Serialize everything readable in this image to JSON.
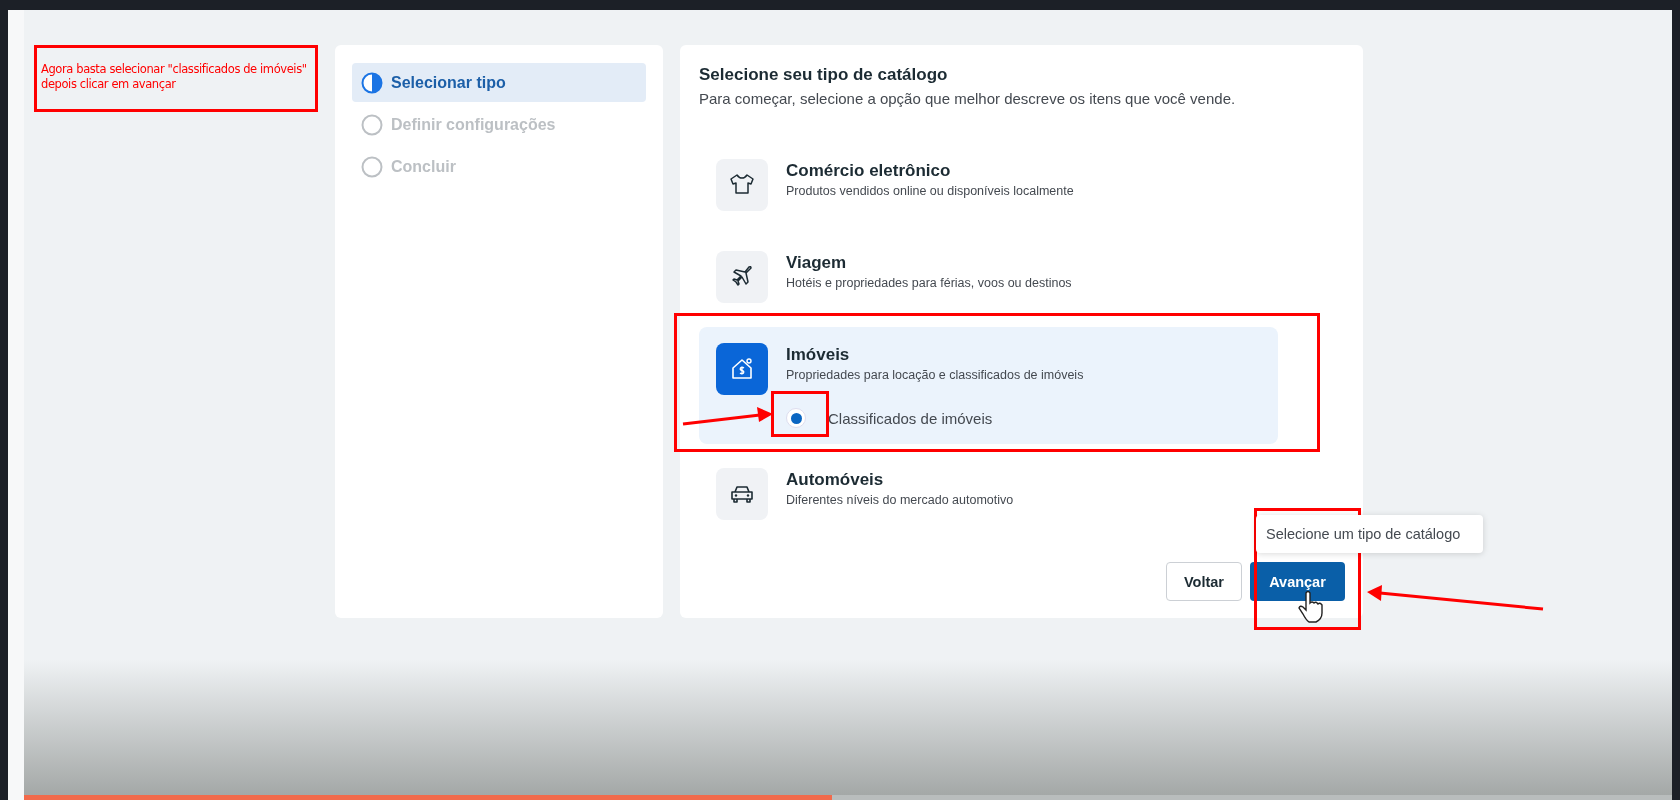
{
  "annotation": {
    "lines": [
      "Agora basta selecionar \"classificados de imóveis\"",
      "depois clicar em avançar"
    ]
  },
  "steps": [
    {
      "label": "Selecionar tipo",
      "selected": true
    },
    {
      "label": "Definir configurações",
      "selected": false
    },
    {
      "label": "Concluir",
      "selected": false
    }
  ],
  "catalog": {
    "title": "Selecione seu tipo de catálogo",
    "subtitle": "Para começar, selecione a opção que melhor descreve os itens que você vende.",
    "options": [
      {
        "kind": "shirt",
        "title": "Comércio eletrônico",
        "description": "Produtos vendidos online ou disponíveis localmente",
        "selected": false
      },
      {
        "kind": "plane",
        "title": "Viagem",
        "description": "Hotéis e propriedades para férias, voos ou destinos",
        "selected": false
      },
      {
        "kind": "house",
        "title": "Imóveis",
        "description": "Propriedades para locação e classificados de imóveis",
        "selected": true,
        "suboptions": [
          {
            "label": "Classificados de imóveis",
            "selected": true
          }
        ]
      },
      {
        "kind": "car",
        "title": "Automóveis",
        "description": "Diferentes níveis do mercado automotivo",
        "selected": false
      }
    ],
    "buttons": [
      {
        "label": "Voltar",
        "kind": "secondary"
      },
      {
        "label": "Avançar",
        "kind": "primary"
      }
    ],
    "tooltip": {
      "text": "Selecione um tipo de catálogo"
    }
  },
  "video_progress": {
    "level": 0.49
  }
}
